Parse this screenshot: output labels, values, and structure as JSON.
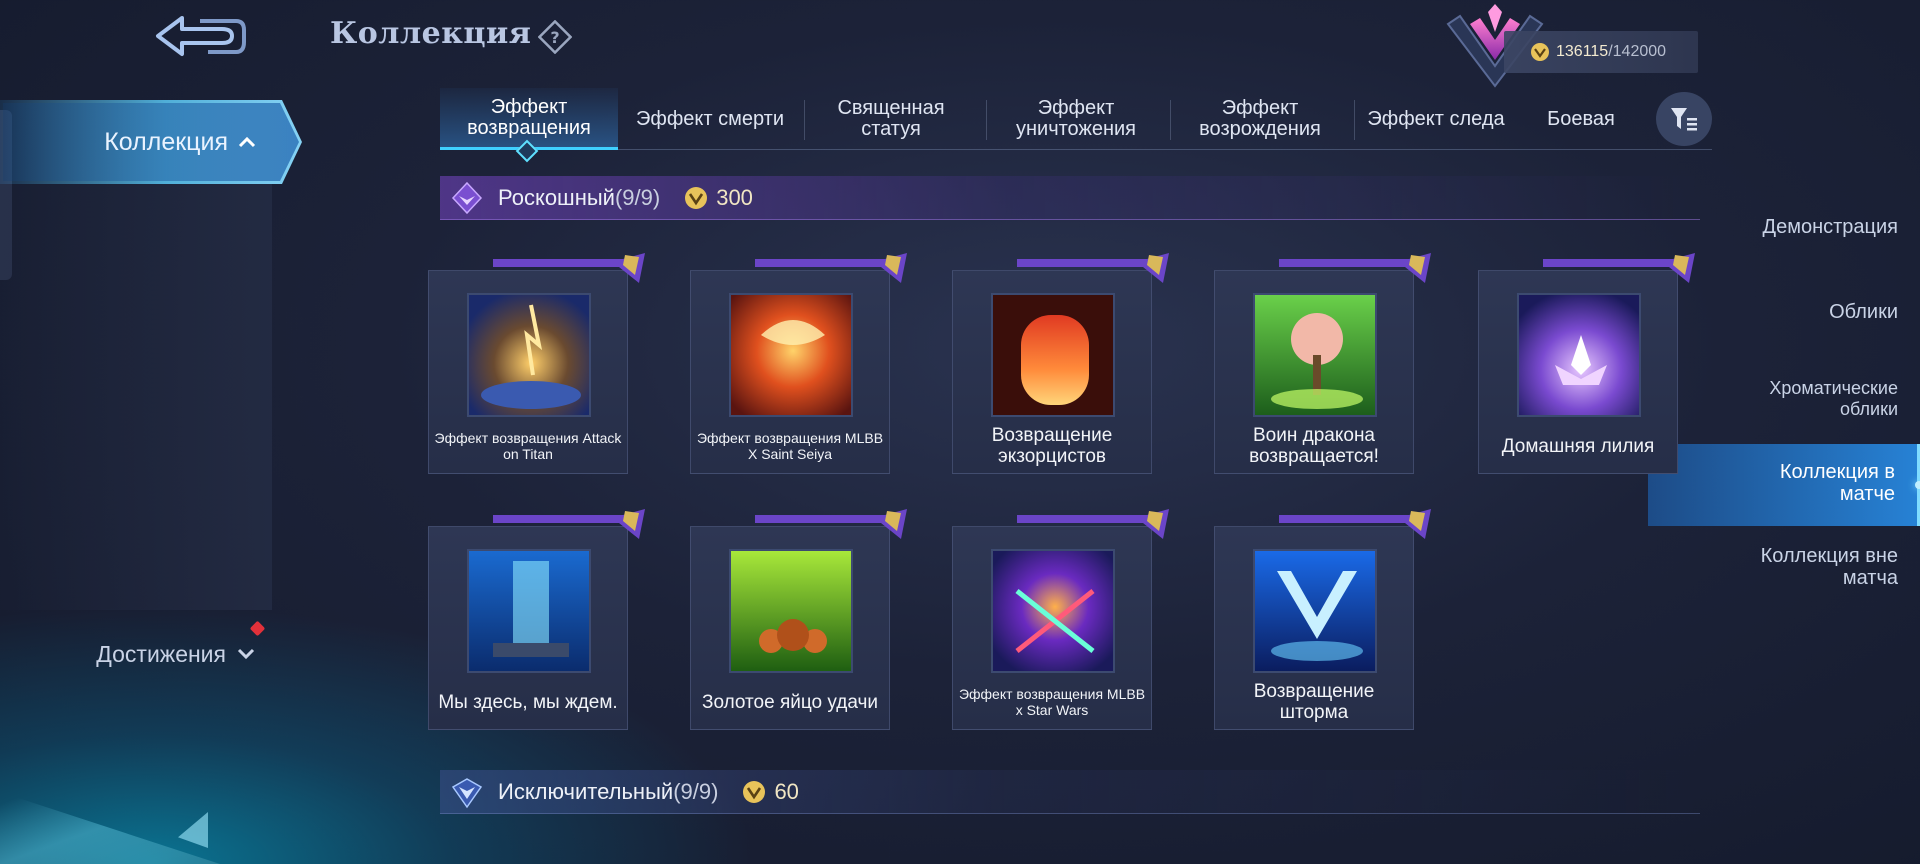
{
  "header": {
    "title": "Коллекция",
    "points_current": "136115",
    "points_separator": "/",
    "points_max": "142000"
  },
  "sidebar": {
    "main": "Коллекция",
    "items": [
      {
        "label": "Демонстрация"
      },
      {
        "label": "Облики"
      },
      {
        "label": "Хроматические облики"
      },
      {
        "label": "Коллекция в матче"
      },
      {
        "label": "Коллекция вне матча"
      }
    ],
    "achievements": "Достижения"
  },
  "tabs": [
    {
      "label": "Эффект возвращения"
    },
    {
      "label": "Эффект смерти"
    },
    {
      "label": "Священная статуя"
    },
    {
      "label": "Эффект уничтожения"
    },
    {
      "label": "Эффект возрождения"
    },
    {
      "label": "Эффект следа"
    },
    {
      "label": "Боевая"
    }
  ],
  "sections": [
    {
      "name": "Роскошный",
      "count": "(9/9)",
      "points": "300",
      "items": [
        {
          "label": "Эффект возвращения Attack on Titan"
        },
        {
          "label": "Эффект возвращения MLBB X Saint Seiya"
        },
        {
          "label": "Возвращение экзорцистов"
        },
        {
          "label": "Воин дракона возвращается!"
        },
        {
          "label": "Домашняя лилия"
        },
        {
          "label": "Мы здесь, мы ждем."
        },
        {
          "label": "Золотое яйцо удачи"
        },
        {
          "label": "Эффект возвращения MLBB x Star Wars"
        },
        {
          "label": "Возвращение шторма"
        }
      ]
    },
    {
      "name": "Исключительный",
      "count": "(9/9)",
      "points": "60"
    }
  ],
  "colors": {
    "accent_cyan": "#3fd0ff",
    "luxury_purple": "#7a4fd0",
    "coin_gold": "#e8c35a"
  }
}
